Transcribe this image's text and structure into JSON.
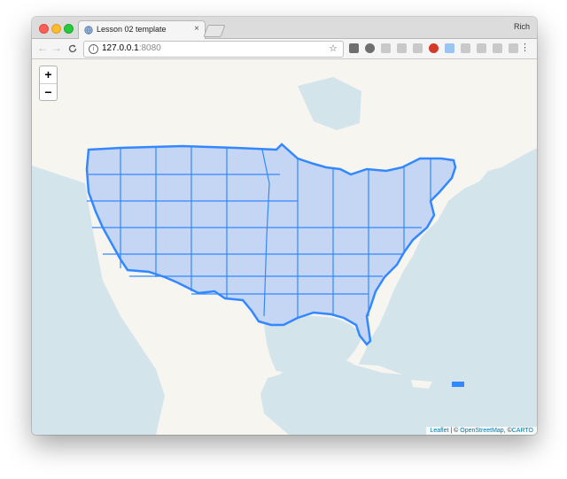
{
  "window": {
    "profile_name": "Rich"
  },
  "tab": {
    "title": "Lesson 02 template",
    "close_glyph": "×"
  },
  "toolbar": {
    "back_glyph": "←",
    "forward_glyph": "→",
    "reload_glyph": "C",
    "url_host": "127.0.0.1",
    "url_port": ":8080",
    "info_glyph": "i",
    "star_glyph": "☆",
    "menu_glyph": "⋮",
    "extensions": [
      "extension-icon",
      "extension-icon",
      "extension-icon",
      "extension-icon",
      "extension-icon",
      "off-extension-icon",
      "extension-icon",
      "extension-icon",
      "extension-icon",
      "extension-icon",
      "extension-icon"
    ]
  },
  "map": {
    "zoom_in": "+",
    "zoom_out": "−",
    "attribution": {
      "leaflet": "Leaflet",
      "sep": " | © ",
      "osm": "OpenStreetMap",
      "carto_prefix": ", ©",
      "carto": "CARTO"
    },
    "colors": {
      "water": "#d4e4eb",
      "land": "#f7f5f0",
      "county_fill": "#c5d6f5",
      "county_stroke": "#3388ff"
    }
  }
}
